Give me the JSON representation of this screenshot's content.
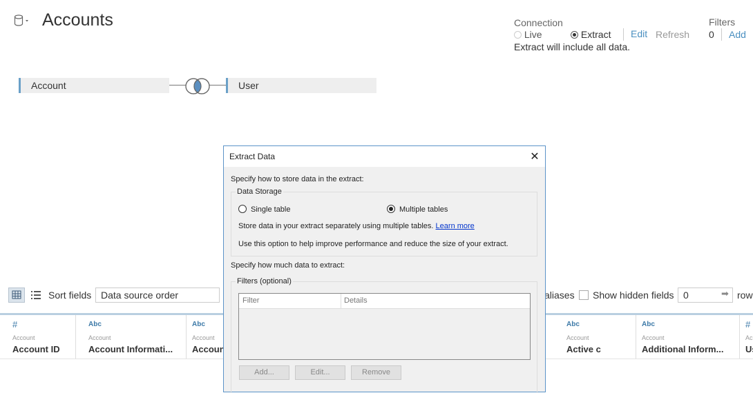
{
  "header": {
    "title": "Accounts",
    "connection_label": "Connection",
    "live_label": "Live",
    "extract_label": "Extract",
    "edit_label": "Edit",
    "refresh_label": "Refresh",
    "extract_note": "Extract will include all data.",
    "filters_label": "Filters",
    "filters_count": "0",
    "add_label": "Add",
    "connection_mode": "Extract"
  },
  "join": {
    "left_table": "Account",
    "right_table": "User",
    "join_type": "inner"
  },
  "toolbar": {
    "sort_label": "Sort fields",
    "sort_value": "Data source order",
    "aliases_label": "aliases",
    "show_hidden_label": "Show hidden fields",
    "show_hidden_checked": false,
    "rows_value": "0",
    "rows_label": "row"
  },
  "columns": [
    {
      "type": "#",
      "source": "Account",
      "name": "Account ID"
    },
    {
      "type": "Abc",
      "source": "Account",
      "name": "Account Informati..."
    },
    {
      "type": "Abc",
      "source": "Account",
      "name": "Account"
    },
    {
      "type": "Abc",
      "source": "Account",
      "name": "Active c"
    },
    {
      "type": "Abc",
      "source": "Account",
      "name": "Additional Inform..."
    },
    {
      "type": "#",
      "source": "Ac",
      "name": "Us"
    }
  ],
  "dialog": {
    "title": "Extract Data",
    "close_glyph": "✕",
    "specify_store": "Specify how to store data in the extract:",
    "data_storage_label": "Data Storage",
    "single_table_label": "Single table",
    "multiple_tables_label": "Multiple tables",
    "selected_storage": "Multiple tables",
    "store_desc": "Store data in your extract separately using multiple tables.",
    "learn_more": "Learn more",
    "use_option_desc": "Use this option to help improve performance and reduce the size of your extract.",
    "specify_amount": "Specify how much data to extract:",
    "filters_label": "Filters (optional)",
    "filter_col": "Filter",
    "details_col": "Details",
    "add_btn": "Add...",
    "edit_btn": "Edit...",
    "remove_btn": "Remove"
  },
  "colors": {
    "accent": "#4a8fc0",
    "table_bar": "#6aa0c8",
    "dialog_border": "#5b93c8"
  }
}
